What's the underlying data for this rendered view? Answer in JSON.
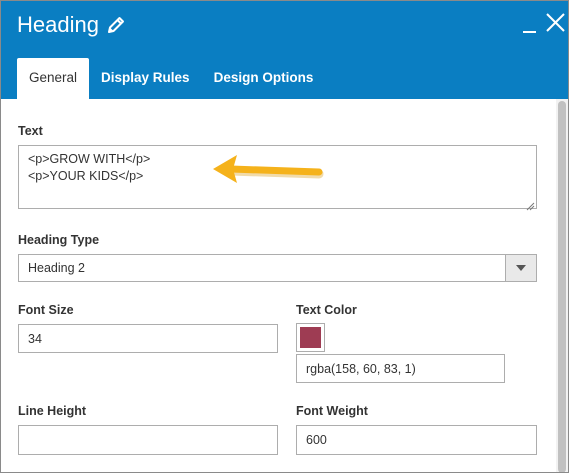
{
  "window": {
    "title": "Heading",
    "title_icon": "pencil-icon",
    "minimize_icon": "minimize-icon",
    "close_icon": "close-icon"
  },
  "tabs": [
    {
      "label": "General",
      "active": true
    },
    {
      "label": "Display Rules",
      "active": false
    },
    {
      "label": "Design Options",
      "active": false
    }
  ],
  "form": {
    "text": {
      "label": "Text",
      "value": "<p>GROW WITH</p>\n<p>YOUR KIDS</p>"
    },
    "heading_type": {
      "label": "Heading Type",
      "value": "Heading 2"
    },
    "font_size": {
      "label": "Font Size",
      "value": "34"
    },
    "text_color": {
      "label": "Text Color",
      "value": "rgba(158, 60, 83, 1)",
      "swatch_color": "#9e3c53"
    },
    "line_height": {
      "label": "Line Height",
      "value": ""
    },
    "font_weight": {
      "label": "Font Weight",
      "value": "600"
    }
  },
  "colors": {
    "header_bg": "#0a7ec2",
    "annotation_arrow": "#f5b21b"
  }
}
